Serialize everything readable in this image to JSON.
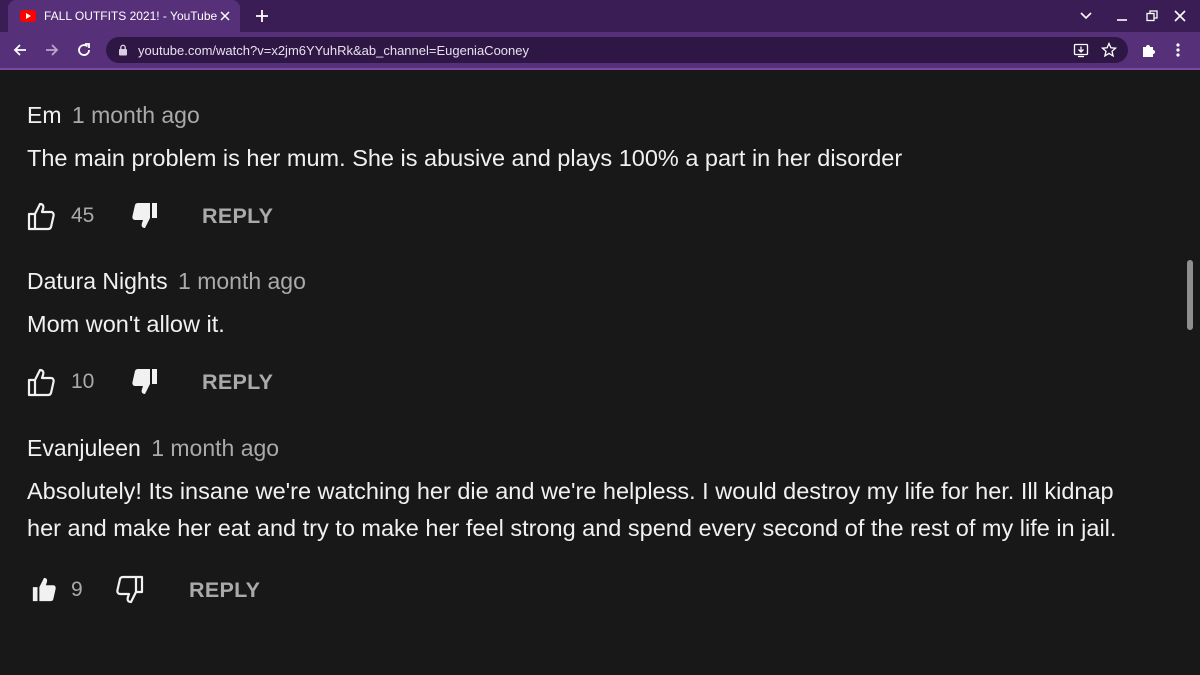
{
  "browser": {
    "tab_title": "FALL OUTFITS 2021! - YouTube",
    "url": "youtube.com/watch?v=x2jm6YYuhRk&ab_channel=EugeniaCooney",
    "accent_color": "#57307a",
    "tab_strip_color": "#3b1d55"
  },
  "comments": [
    {
      "author": "Em",
      "time": "1 month ago",
      "text": "The main problem is her mum. She is abusive and plays 100% a part in her disorder",
      "likes": "45",
      "reply_label": "REPLY",
      "liked": false
    },
    {
      "author": "Datura Nights",
      "time": "1 month ago",
      "text": "Mom won't allow it.",
      "likes": "10",
      "reply_label": "REPLY",
      "liked": false
    },
    {
      "author": "Evanjuleen",
      "time": "1 month ago",
      "text": "Absolutely! Its insane we're watching her die and we're helpless. I would destroy my life for her. Ill kidnap her and make her eat and try to make her feel strong and spend every second of the rest of my life in jail.",
      "likes": "9",
      "reply_label": "REPLY",
      "liked": true
    }
  ],
  "icons": {
    "favicon": "youtube-icon",
    "like": "thumbs-up-icon",
    "dislike": "thumbs-down-icon"
  }
}
